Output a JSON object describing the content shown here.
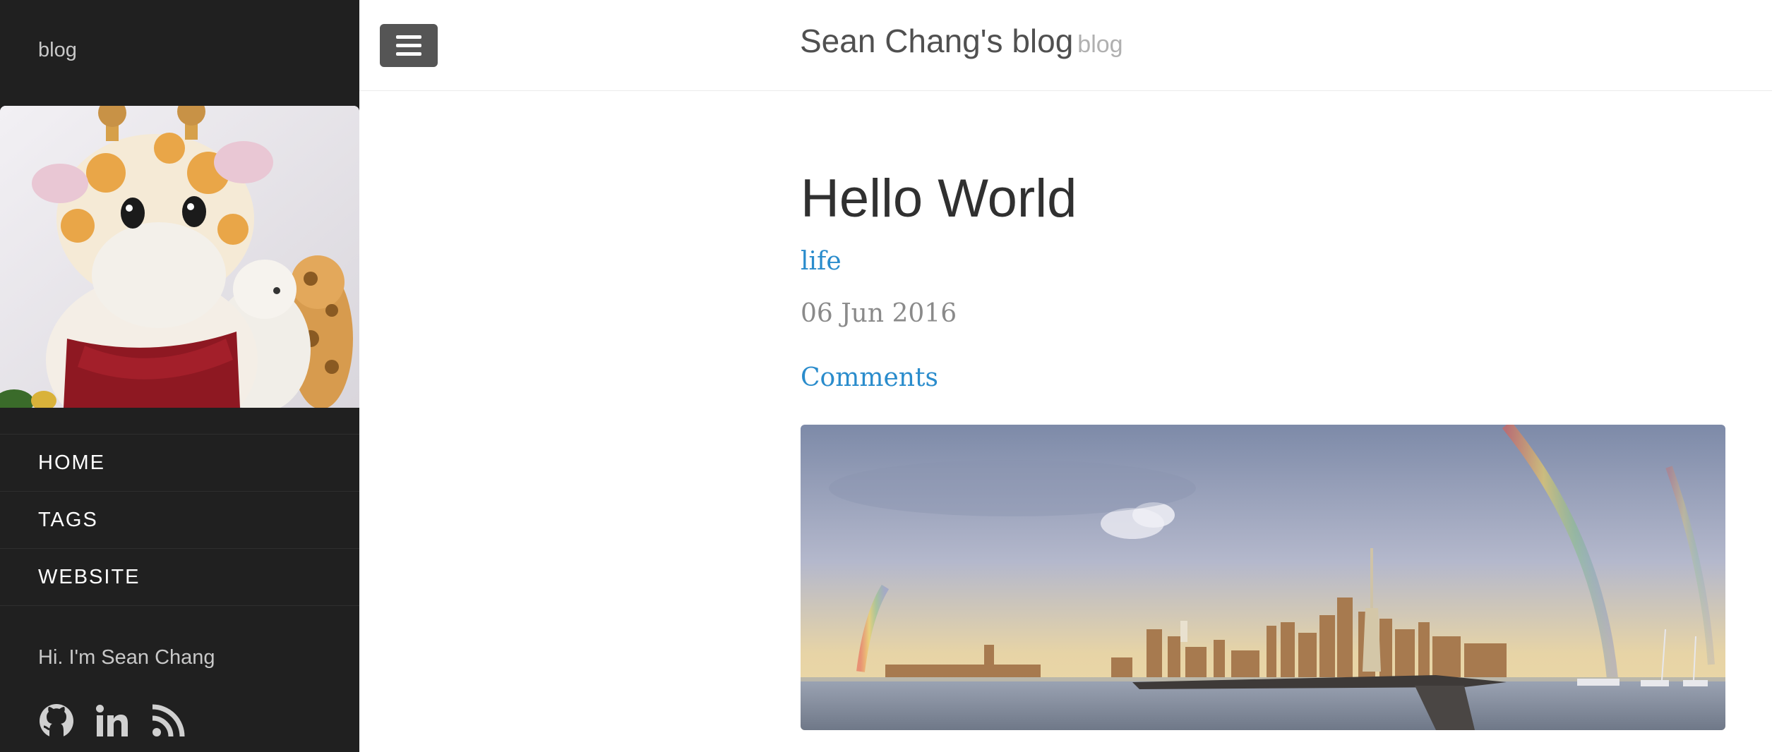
{
  "sidebar": {
    "brand": "blog",
    "avatar_alt": "plush giraffe toys",
    "nav": [
      {
        "label": "HOME"
      },
      {
        "label": "TAGS"
      },
      {
        "label": "WEBSITE"
      }
    ],
    "intro": "Hi. I'm Sean Chang",
    "social_icons": [
      "github-icon",
      "linkedin-icon",
      "rss-icon"
    ]
  },
  "header": {
    "menu_icon": "hamburger-icon",
    "title": "Sean Chang's blog",
    "subtitle": "blog"
  },
  "post": {
    "title": "Hello World",
    "tag": "life",
    "date": "06 Jun 2016",
    "comments_label": "Comments",
    "image_alt": "city skyline with rainbows over the river"
  },
  "colors": {
    "sidebar_bg": "#202020",
    "link": "#2a8ccc",
    "menu_button": "#555555"
  }
}
